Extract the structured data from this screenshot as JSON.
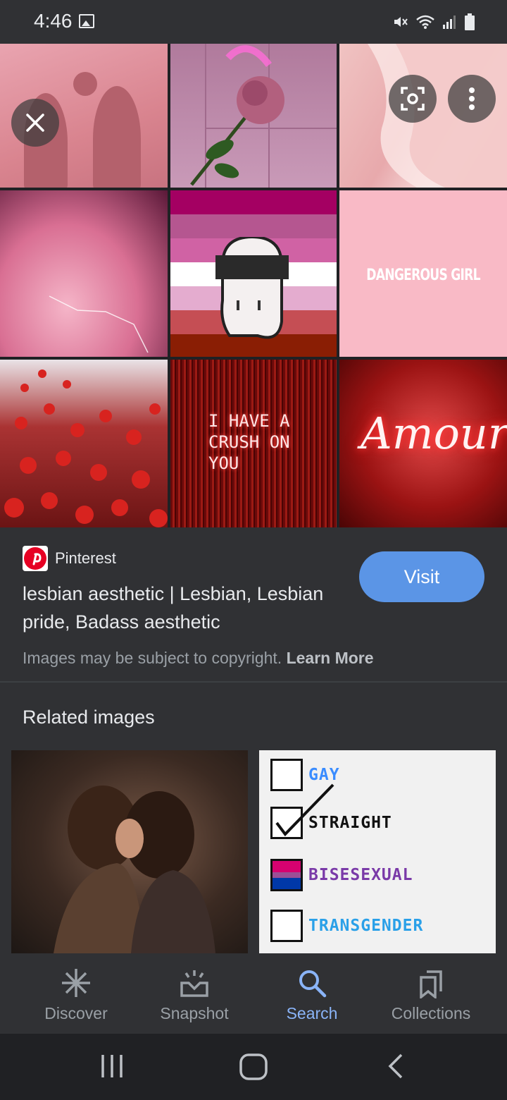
{
  "status_bar": {
    "time": "4:46"
  },
  "image_grid": {
    "tiles": [
      {
        "text": ""
      },
      {
        "text": ""
      },
      {
        "text": ""
      },
      {
        "text": ""
      },
      {
        "text": ""
      },
      {
        "text": "DANGEROUS GIRL"
      },
      {
        "text": ""
      },
      {
        "text": "I HAVE A CRUSH ON YOU"
      },
      {
        "text": "Amour"
      }
    ]
  },
  "source": {
    "site_name": "Pinterest",
    "title": "lesbian aesthetic | Lesbian, Lesbian pride, Badass aesthetic",
    "visit_label": "Visit",
    "copyright_text": "Images may be subject to copyright.",
    "learn_more_label": "Learn More"
  },
  "related": {
    "heading": "Related images",
    "checklist": [
      {
        "label": "GAY",
        "checked": false
      },
      {
        "label": "STRAIGHT",
        "checked": true
      },
      {
        "label": "BISESEXUAL",
        "checked": false
      },
      {
        "label": "TRANSGENDER",
        "checked": false
      }
    ]
  },
  "bottom_nav": {
    "items": [
      {
        "label": "Discover",
        "icon": "asterisk-icon"
      },
      {
        "label": "Snapshot",
        "icon": "snapshot-icon"
      },
      {
        "label": "Search",
        "icon": "search-icon",
        "active": true
      },
      {
        "label": "Collections",
        "icon": "collections-icon"
      }
    ]
  },
  "colors": {
    "accent": "#8ab4f8",
    "visit_button": "#5b95e6",
    "panel": "#303134",
    "background": "#202124"
  }
}
